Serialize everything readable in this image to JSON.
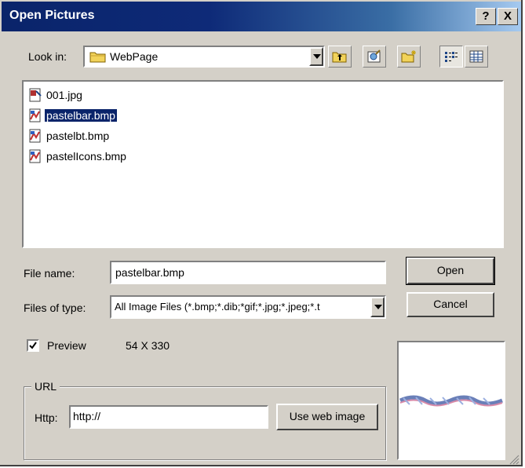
{
  "window": {
    "title": "Open Pictures",
    "help_btn": "?",
    "close_btn": "X"
  },
  "look_in": {
    "label": "Look in:",
    "value": "WebPage"
  },
  "files": [
    {
      "name": "001.jpg",
      "icon": "jpg-file-icon"
    },
    {
      "name": "pastelbar.bmp",
      "icon": "bmp-file-icon",
      "selected": true
    },
    {
      "name": "pastelbt.bmp",
      "icon": "bmp-file-icon"
    },
    {
      "name": "pastelIcons.bmp",
      "icon": "bmp-file-icon"
    }
  ],
  "file_name": {
    "label": "File name:",
    "value": "pastelbar.bmp"
  },
  "file_type": {
    "label": "Files of type:",
    "value": "All Image Files (*.bmp;*.dib;*gif;*.jpg;*.jpeg;*.t"
  },
  "buttons": {
    "open": "Open",
    "cancel": "Cancel",
    "use_web_image": "Use web image"
  },
  "preview": {
    "label": "Preview",
    "checked": true,
    "dimensions": "54 X 330"
  },
  "url": {
    "group_label": "URL",
    "http_label": "Http:",
    "value": "http://"
  },
  "colors": {
    "face": "#d4d0c8",
    "titlebar": "#0a246a",
    "selection": "#0a246a"
  }
}
